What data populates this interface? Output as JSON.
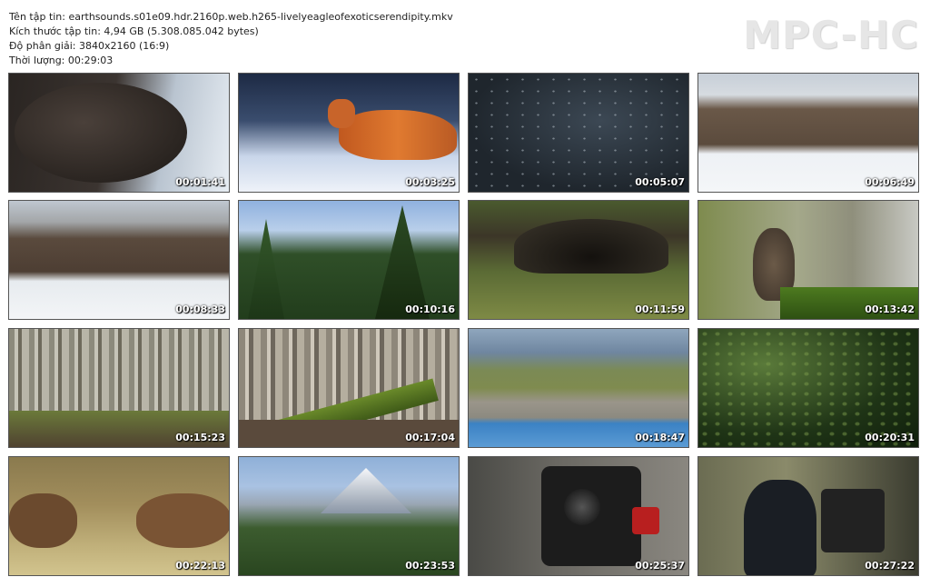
{
  "header": {
    "file_name": "Tên tập tin: earthsounds.s01e09.hdr.2160p.web.h265-livelyeagleofexoticserendipity.mkv",
    "file_size": "Kích thước tập tin: 4,94 GB (5.308.085.042 bytes)",
    "resolution": "Độ phân giải: 3840x2160 (16:9)",
    "duration": "Thời lượng: 00:29:03"
  },
  "logo": "MPC-HC",
  "thumbnails": [
    {
      "time": "00:01:41"
    },
    {
      "time": "00:03:25"
    },
    {
      "time": "00:05:07"
    },
    {
      "time": "00:06:49"
    },
    {
      "time": "00:08:33"
    },
    {
      "time": "00:10:16"
    },
    {
      "time": "00:11:59"
    },
    {
      "time": "00:13:42"
    },
    {
      "time": "00:15:23"
    },
    {
      "time": "00:17:04"
    },
    {
      "time": "00:18:47"
    },
    {
      "time": "00:20:31"
    },
    {
      "time": "00:22:13"
    },
    {
      "time": "00:23:53"
    },
    {
      "time": "00:25:37"
    },
    {
      "time": "00:27:22"
    }
  ]
}
